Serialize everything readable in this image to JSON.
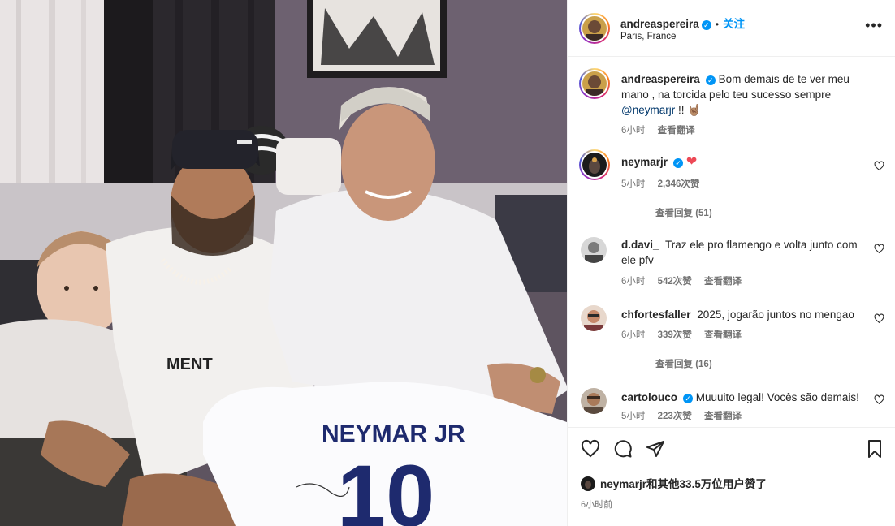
{
  "post": {
    "author": "andreaspereira",
    "verified_mark": "✓",
    "separator": "•",
    "follow_label": "关注",
    "location": "Paris, France",
    "more_icon": "more-dots-icon",
    "jersey_name": "NEYMAR JR",
    "jersey_number": "10",
    "shirt_text": "MENT"
  },
  "caption": {
    "user": "andreaspereira",
    "text": "Bom demais de te ver meu mano , na torcida pelo teu sucesso sempre",
    "mention": "@neymarjr",
    "suffix": " !! 🤘🏽",
    "time": "6小时",
    "translate": "查看翻译"
  },
  "comments": [
    {
      "user": "neymarjr",
      "verified": true,
      "text": "❤",
      "time": "5小时",
      "likes": "2,346次赞",
      "translate": "",
      "view_replies": "查看回复 (51)"
    },
    {
      "user": "d.davi_",
      "verified": false,
      "text": "Traz ele pro flamengo e volta junto com ele pfv",
      "time": "6小时",
      "likes": "542次赞",
      "translate": "查看翻译",
      "view_replies": ""
    },
    {
      "user": "chfortesfaller",
      "verified": false,
      "text": "2025, jogarão juntos no mengao",
      "time": "6小时",
      "likes": "339次赞",
      "translate": "查看翻译",
      "view_replies": "查看回复 (16)"
    },
    {
      "user": "cartolouco",
      "verified": true,
      "text": "Muuuito legal! Vocês são demais!",
      "time": "5小时",
      "likes": "223次赞",
      "translate": "查看翻译",
      "view_replies": ""
    }
  ],
  "actions": {
    "like_icon": "heart-icon",
    "comment_icon": "comment-icon",
    "share_icon": "share-icon",
    "save_icon": "bookmark-icon"
  },
  "likes_summary": {
    "user": "neymarjr",
    "rest": "和其他33.5万位用户赞了"
  },
  "timestamp": "6小时前",
  "colors": {
    "accent": "#0095f6",
    "like_red": "#ed4956",
    "muted": "#737373",
    "text": "#262626"
  }
}
